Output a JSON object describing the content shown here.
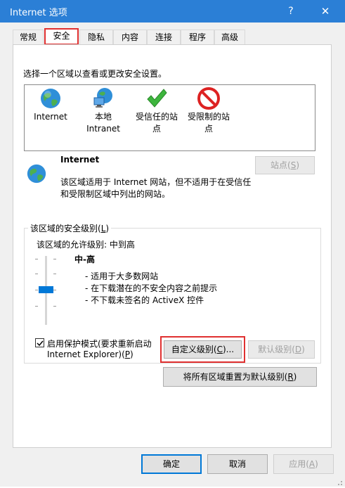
{
  "window": {
    "title": "Internet 选项",
    "help_label": "?",
    "close_label": "✕"
  },
  "tabs": [
    {
      "label": "常规"
    },
    {
      "label": "安全"
    },
    {
      "label": "隐私"
    },
    {
      "label": "内容"
    },
    {
      "label": "连接"
    },
    {
      "label": "程序"
    },
    {
      "label": "高级"
    }
  ],
  "security": {
    "instruction": "选择一个区域以查看或更改安全设置。",
    "zones": [
      {
        "line1": "Internet",
        "line2": "",
        "icon": "globe-icon"
      },
      {
        "line1": "本地",
        "line2": "Intranet",
        "icon": "local-intranet-icon"
      },
      {
        "line1": "受信任的站",
        "line2": "点",
        "icon": "check-icon"
      },
      {
        "line1": "受限制的站",
        "line2": "点",
        "icon": "restricted-icon"
      }
    ],
    "selected_zone": {
      "name": "Internet",
      "desc_line1": "该区域适用于 Internet 网站，但不适用于在受信任",
      "desc_line2": "和受限制区域中列出的网站。"
    },
    "sites_button": {
      "label": "站点(",
      "key": "S",
      "end": ")"
    },
    "level_group": {
      "title": "该区域的安全级别(",
      "key": "L",
      "end": ")"
    },
    "allowed_levels": "该区域的允许级别: 中到高",
    "level_name": "中-高",
    "level_bullets": [
      "- 适用于大多数网站",
      "- 在下载潜在的不安全内容之前提示",
      "- 不下载未签名的 ActiveX 控件"
    ],
    "protected_mode": {
      "checked": true,
      "line1": "启用保护模式(要求重新启动",
      "line2": "Internet Explorer)(",
      "key": "P",
      "end": ")"
    },
    "custom_level_button": {
      "label": "自定义级别(",
      "key": "C",
      "end": ")..."
    },
    "default_level_button": {
      "label": "默认级别(",
      "key": "D",
      "end": ")"
    },
    "reset_all_button": {
      "label": "将所有区域重置为默认级别(",
      "key": "R",
      "end": ")"
    }
  },
  "footer": {
    "ok": "确定",
    "cancel": "取消",
    "apply": {
      "label": "应用(",
      "key": "A",
      "end": ")"
    }
  },
  "colors": {
    "titlebar": "#2b7fd6",
    "highlight": "#e03030",
    "slider_thumb": "#0078d7"
  }
}
